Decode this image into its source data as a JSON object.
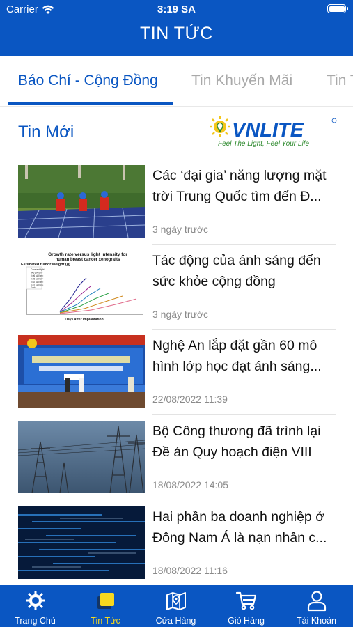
{
  "status_bar": {
    "carrier": "Carrier",
    "time": "3:19 SA"
  },
  "header": {
    "title": "TIN TỨC"
  },
  "tabs": [
    {
      "label": "Báo Chí - Cộng Đồng",
      "active": true
    },
    {
      "label": "Tin Khuyến Mãi",
      "active": false
    },
    {
      "label": "Tin T",
      "active": false
    }
  ],
  "section": {
    "title": "Tin Mới",
    "logo_text": "VNLITE",
    "logo_tagline": "Feel The Light, Feel Your Life"
  },
  "news": [
    {
      "headline": "Các ‘đại gia’ năng lượng mặt trời Trung Quốc tìm đến Đ...",
      "date": "3 ngày trước",
      "thumb_icon": "solar-panel-workers-photo"
    },
    {
      "headline": "Tác động của ánh sáng đến sức khỏe cộng đồng",
      "date": "3 ngày trước",
      "thumb_icon": "growth-rate-chart-image"
    },
    {
      "headline": "Nghệ An lắp đặt gần 60 mô hình lớp học đạt ánh sáng...",
      "date": "22/08/2022 11:39",
      "thumb_icon": "ceremony-stage-photo"
    },
    {
      "headline": "Bộ Công thương đã trình lại Đề án Quy hoạch điện VIII",
      "date": "18/08/2022 14:05",
      "thumb_icon": "power-tower-photo"
    },
    {
      "headline": "Hai phần ba doanh nghiệp ở Đông Nam Á là nạn nhân c...",
      "date": "18/08/2022 11:16",
      "thumb_icon": "cyber-data-photo"
    }
  ],
  "thumb_chart": {
    "title": "Growth rate versus light intensity for",
    "subtitle": "human breast cancer xenografts",
    "ylabel": "Estimated tumor weight (g)",
    "xlabel": "Days after implantation",
    "legend": [
      "Constant light",
      "345 µW/cm²",
      "0.06 µW/cm²",
      "0.08 µW/cm²",
      "0.02 µW/cm²",
      "0.01 µW/cm²",
      "Dark"
    ]
  },
  "bottom_nav": [
    {
      "label": "Trang Chủ",
      "icon": "gear-sun-icon",
      "active": false
    },
    {
      "label": "Tin Tức",
      "icon": "news-icon",
      "active": true
    },
    {
      "label": "Cửa Hàng",
      "icon": "map-icon",
      "active": false
    },
    {
      "label": "Giỏ Hàng",
      "icon": "cart-icon",
      "active": false
    },
    {
      "label": "Tài Khoản",
      "icon": "user-icon",
      "active": false
    }
  ],
  "colors": {
    "primary": "#0a56c2",
    "active_nav": "#f6d81f",
    "logo_green": "#2e8a2e"
  }
}
